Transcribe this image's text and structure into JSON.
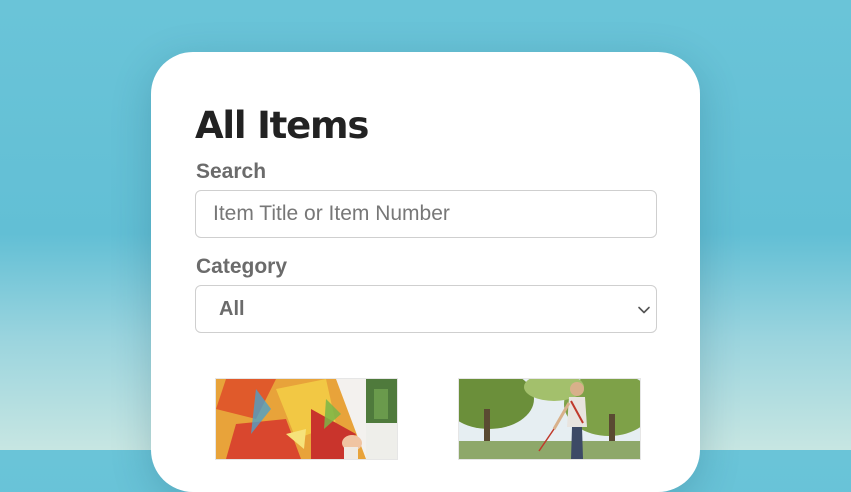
{
  "page": {
    "title": "All Items"
  },
  "search": {
    "label": "Search",
    "placeholder": "Item Title or Item Number",
    "value": ""
  },
  "category": {
    "label": "Category",
    "selected": "All",
    "icon": "chevron-down-icon"
  },
  "items": [
    {
      "thumbnail": "painting-in-progress-thumbnail"
    },
    {
      "thumbnail": "person-walking-dog-in-park-thumbnail"
    }
  ],
  "colors": {
    "background_top": "#6ac4d8",
    "background_bottom": "#c7e6e2",
    "card": "#ffffff",
    "title": "#222222",
    "label": "#6b6b6b",
    "border": "#cfcfcf"
  }
}
